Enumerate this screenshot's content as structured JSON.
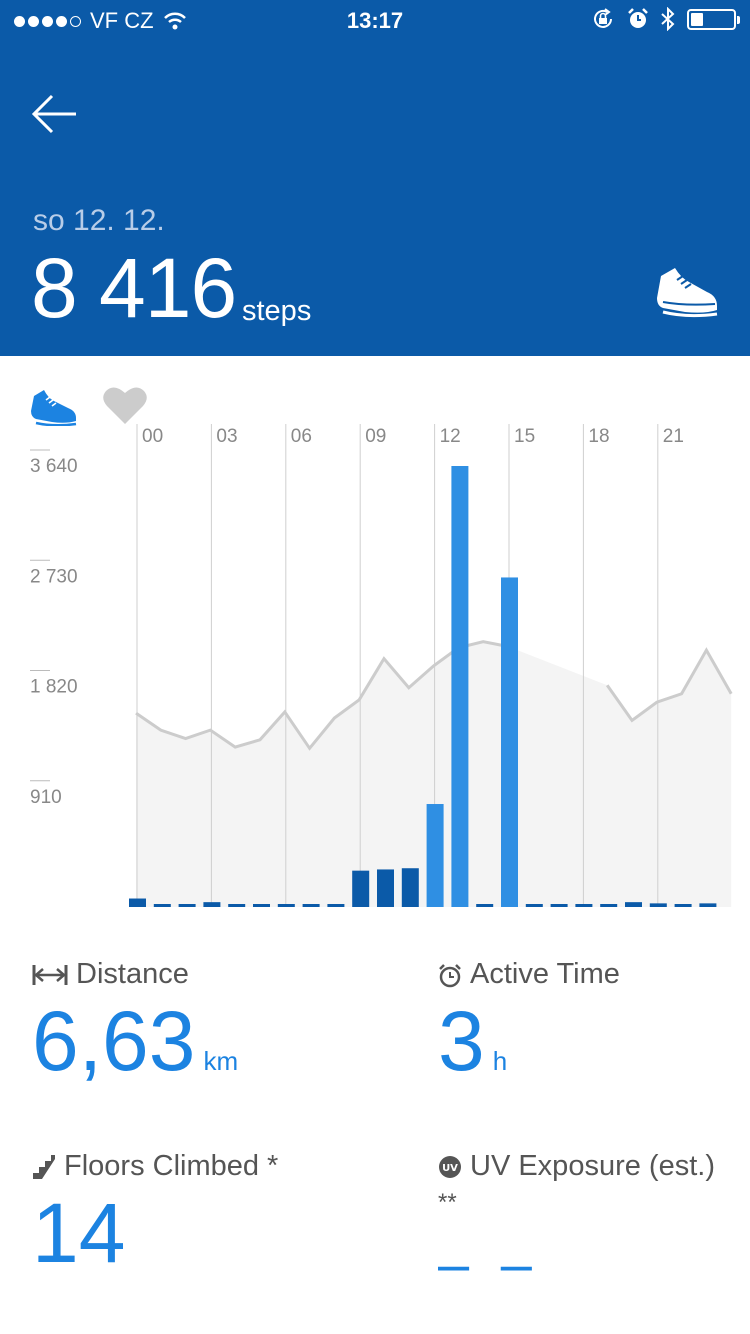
{
  "status_bar": {
    "carrier": "VF CZ",
    "time": "13:17",
    "signal_bars": 4,
    "battery_level": 0.3
  },
  "header": {
    "date": "so 12. 12.",
    "steps_value": "8 416",
    "steps_unit": "steps",
    "icons": [
      "back-arrow-icon",
      "shoe-icon"
    ],
    "bg_color": "#0b5aa8"
  },
  "chart_data": {
    "type": "bar",
    "x_tick_labels": [
      "00",
      "03",
      "06",
      "09",
      "12",
      "15",
      "18",
      "21"
    ],
    "y_tick_labels": [
      "3 640",
      "2 730",
      "1 820",
      "910"
    ],
    "y_ticks": [
      3640,
      2730,
      1820,
      910
    ],
    "ylim": [
      0,
      3800
    ],
    "categories": [
      "0",
      "1",
      "2",
      "3",
      "4",
      "5",
      "6",
      "7",
      "8",
      "9",
      "10",
      "11",
      "12",
      "13",
      "14",
      "15",
      "16",
      "17",
      "18",
      "19",
      "20",
      "21",
      "22",
      "23"
    ],
    "series": [
      {
        "values": [
          70,
          10,
          10,
          40,
          10,
          10,
          10,
          10,
          10,
          300,
          310,
          320,
          850,
          3640,
          20,
          2720,
          10,
          10,
          10,
          10,
          40,
          30,
          20,
          30
        ]
      }
    ],
    "highlight_hours": [
      12,
      13,
      15
    ],
    "average_line": [
      1600,
      1460,
      1390,
      1460,
      1320,
      1380,
      1610,
      1310,
      1560,
      1710,
      2050,
      1810,
      1990,
      2140,
      2190,
      2150,
      null,
      null,
      null,
      1830,
      1540,
      1690,
      1760,
      2120,
      1760
    ],
    "colors": {
      "bar": "#0b5aa8",
      "bar_highlight": "#2f8fe3",
      "average": "#cccccc",
      "average_fill": "#f4f4f4"
    }
  },
  "stats": {
    "distance": {
      "label": "Distance",
      "value": "6,63",
      "unit": "km",
      "icon": "distance-arrows-icon"
    },
    "active_time": {
      "label": "Active Time",
      "value": "3",
      "unit": "h",
      "icon": "alarm-clock-icon"
    },
    "floors": {
      "label": "Floors Climbed *",
      "value": "14",
      "icon": "stairs-icon"
    },
    "uv": {
      "label": "UV Exposure (est.)",
      "sub": "**",
      "value": "– –",
      "icon": "uv-icon"
    }
  },
  "accent_color": "#1c83e1"
}
